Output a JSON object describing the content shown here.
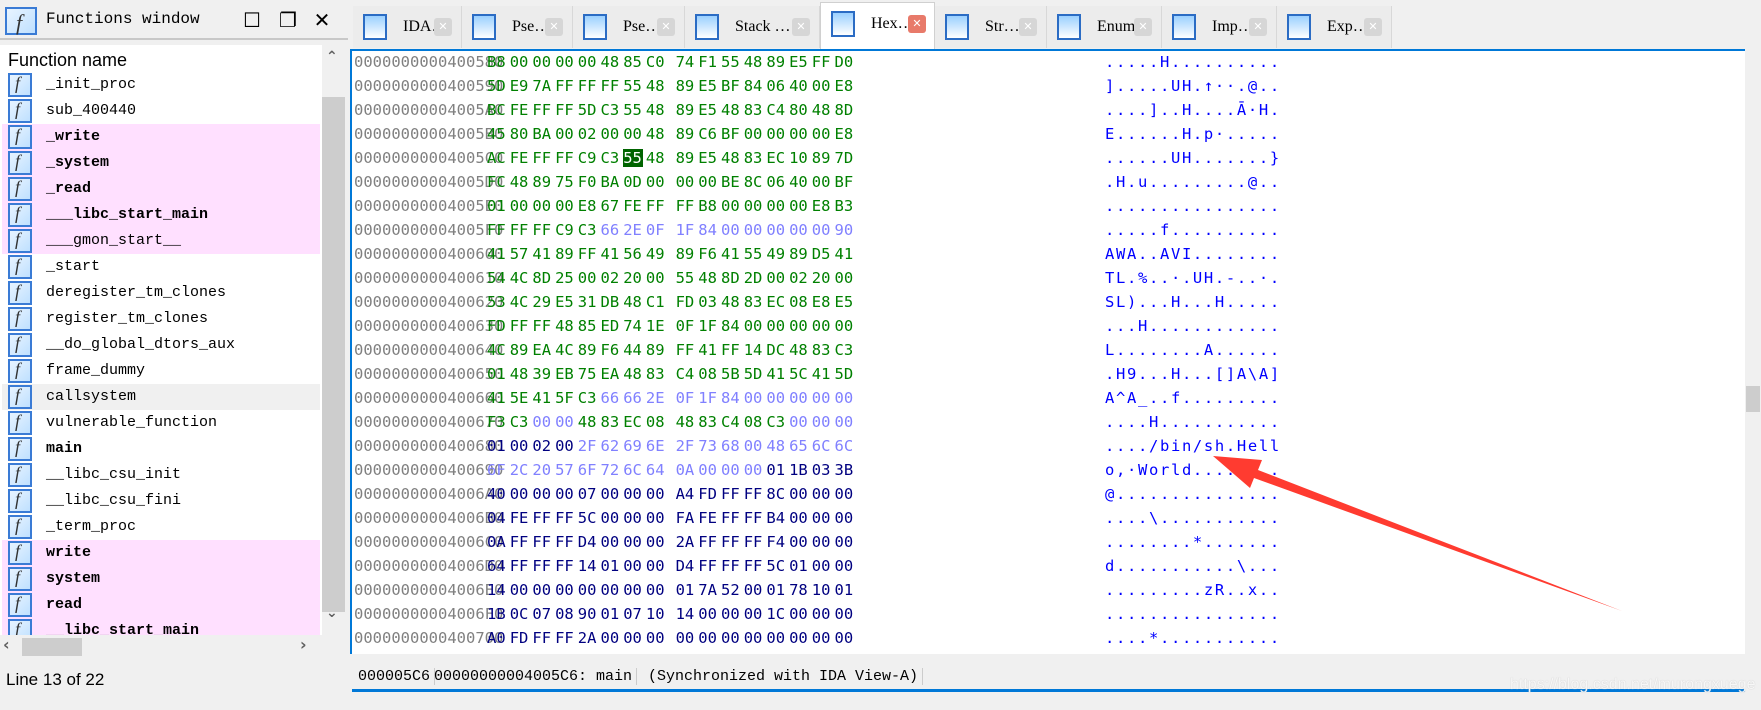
{
  "functions_window": {
    "title": "Functions window",
    "column_header": "Function name",
    "status": "Line 13 of 22",
    "items": [
      {
        "name": "_init_proc",
        "style": ""
      },
      {
        "name": "sub_400440",
        "style": ""
      },
      {
        "name": "_write",
        "style": "pink bold"
      },
      {
        "name": "_system",
        "style": "pink bold"
      },
      {
        "name": "_read",
        "style": "pink bold"
      },
      {
        "name": "___libc_start_main",
        "style": "pink bold"
      },
      {
        "name": "___gmon_start__",
        "style": "pink"
      },
      {
        "name": "_start",
        "style": ""
      },
      {
        "name": "deregister_tm_clones",
        "style": ""
      },
      {
        "name": "register_tm_clones",
        "style": ""
      },
      {
        "name": "__do_global_dtors_aux",
        "style": ""
      },
      {
        "name": "frame_dummy",
        "style": ""
      },
      {
        "name": "callsystem",
        "style": "sel"
      },
      {
        "name": "vulnerable_function",
        "style": ""
      },
      {
        "name": "main",
        "style": "bold"
      },
      {
        "name": "__libc_csu_init",
        "style": ""
      },
      {
        "name": "__libc_csu_fini",
        "style": ""
      },
      {
        "name": "_term_proc",
        "style": ""
      },
      {
        "name": "write",
        "style": "pink bold"
      },
      {
        "name": "system",
        "style": "pink bold"
      },
      {
        "name": "read",
        "style": "pink bold"
      },
      {
        "name": "__libc_start_main",
        "style": "pink bold"
      }
    ]
  },
  "tabs": [
    {
      "label": "IDA…",
      "icon": "disassembly-icon",
      "active": false
    },
    {
      "label": "Pse…",
      "icon": "pseudocode-icon",
      "active": false
    },
    {
      "label": "Pse…",
      "icon": "pseudocode-icon",
      "active": false
    },
    {
      "label": "Stack …",
      "icon": "stack-icon",
      "active": false
    },
    {
      "label": "Hex…",
      "icon": "hex-icon",
      "active": true
    },
    {
      "label": "Str…",
      "icon": "strings-icon",
      "active": false
    },
    {
      "label": "Enums",
      "icon": "enums-icon",
      "active": false
    },
    {
      "label": "Imp…",
      "icon": "imports-icon",
      "active": false
    },
    {
      "label": "Exp…",
      "icon": "exports-icon",
      "active": false
    }
  ],
  "colors": {
    "code": "#008000",
    "unexplored": "#8080ff",
    "data": "#000080",
    "ascii": "#0000ff",
    "address": "#808080",
    "cursor_bg": "#006400",
    "arrow": "#ff3b30"
  },
  "hex_view": {
    "cursor": {
      "row": "00000000004005C0",
      "byte_index": 6
    },
    "rows": [
      {
        "addr": "0000000000400580",
        "bytes": "B8 00 00 00 00 48 85 C0 74 F1 55 48 89 E5 FF D0",
        "types": "cccccccccccccccc",
        "ascii": ".....H.........."
      },
      {
        "addr": "0000000000400590",
        "bytes": "5D E9 7A FF FF FF 55 48 89 E5 BF 84 06 40 00 E8",
        "types": "cccccccccccccccc",
        "ascii": "].....UH.↑··.@.."
      },
      {
        "addr": "00000000004005A0",
        "bytes": "BC FE FF FF 5D C3 55 48 89 E5 48 83 C4 80 48 8D",
        "types": "cccccccccccccccc",
        "ascii": "....]..H....Ā·H."
      },
      {
        "addr": "00000000004005B0",
        "bytes": "45 80 BA 00 02 00 00 48 89 C6 BF 00 00 00 00 E8",
        "types": "cccccccccccccccc",
        "ascii": "E......H.p·....."
      },
      {
        "addr": "00000000004005C0",
        "bytes": "AC FE FF FF C9 C3 55 48 89 E5 48 83 EC 10 89 7D",
        "types": "cccccccccccccccc",
        "ascii": "......UH.......}"
      },
      {
        "addr": "00000000004005D0",
        "bytes": "FC 48 89 75 F0 BA 0D 00 00 00 BE 8C 06 40 00 BF",
        "types": "cccccccccccccccc",
        "ascii": ".H.u.........@.."
      },
      {
        "addr": "00000000004005E0",
        "bytes": "01 00 00 00 E8 67 FE FF FF B8 00 00 00 00 E8 B3",
        "types": "cccccccccccccccc",
        "ascii": "................"
      },
      {
        "addr": "00000000004005F0",
        "bytes": "FF FF FF C9 C3 66 2E 0F 1F 84 00 00 00 00 00 90",
        "types": "cccccaaaaaaaaaaa",
        "ascii": ".....f.........."
      },
      {
        "addr": "0000000000400600",
        "bytes": "41 57 41 89 FF 41 56 49 89 F6 41 55 49 89 D5 41",
        "types": "cccccccccccccccc",
        "ascii": "AWA..AVI........"
      },
      {
        "addr": "0000000000400610",
        "bytes": "54 4C 8D 25 00 02 20 00 55 48 8D 2D 00 02 20 00",
        "types": "cccccccccccccccc",
        "ascii": "TL.%..·.UH.-..·."
      },
      {
        "addr": "0000000000400620",
        "bytes": "53 4C 29 E5 31 DB 48 C1 FD 03 48 83 EC 08 E8 E5",
        "types": "cccccccccccccccc",
        "ascii": "SL)...H...H....."
      },
      {
        "addr": "0000000000400630",
        "bytes": "FD FF FF 48 85 ED 74 1E 0F 1F 84 00 00 00 00 00",
        "types": "cccccccccccccccc",
        "ascii": "...H............"
      },
      {
        "addr": "0000000000400640",
        "bytes": "4C 89 EA 4C 89 F6 44 89 FF 41 FF 14 DC 48 83 C3",
        "types": "cccccccccccccccc",
        "ascii": "L........A......"
      },
      {
        "addr": "0000000000400650",
        "bytes": "01 48 39 EB 75 EA 48 83 C4 08 5B 5D 41 5C 41 5D",
        "types": "cccccccccccccccc",
        "ascii": ".H9...H...[]A\\A]"
      },
      {
        "addr": "0000000000400660",
        "bytes": "41 5E 41 5F C3 66 66 2E 0F 1F 84 00 00 00 00 00",
        "types": "cccccaaaaaaaaaaa",
        "ascii": "A^A_..f........."
      },
      {
        "addr": "0000000000400670",
        "bytes": "F3 C3 00 00 48 83 EC 08 48 83 C4 08 C3 00 00 00",
        "types": "ccaacccccccccaaa",
        "ascii": "....H..........."
      },
      {
        "addr": "0000000000400680",
        "bytes": "01 00 02 00 2F 62 69 6E 2F 73 68 00 48 65 6C 6C",
        "types": "ddddaaaaaaaaaaaa",
        "ascii": "..../bin/sh.Hell"
      },
      {
        "addr": "0000000000400690",
        "bytes": "6F 2C 20 57 6F 72 6C 64 0A 00 00 00 01 1B 03 3B",
        "types": "aaaaaaaaaaaadddd",
        "ascii": "o,·World........"
      },
      {
        "addr": "00000000004006A0",
        "bytes": "40 00 00 00 07 00 00 00 A4 FD FF FF 8C 00 00 00",
        "types": "dddddddddddddddd",
        "ascii": "@..............."
      },
      {
        "addr": "00000000004006B0",
        "bytes": "04 FE FF FF 5C 00 00 00 FA FE FF FF B4 00 00 00",
        "types": "dddddddddddddddd",
        "ascii": "....\\..........."
      },
      {
        "addr": "00000000004006C0",
        "bytes": "0A FF FF FF D4 00 00 00 2A FF FF FF F4 00 00 00",
        "types": "dddddddddddddddd",
        "ascii": "........*......."
      },
      {
        "addr": "00000000004006D0",
        "bytes": "64 FF FF FF 14 01 00 00 D4 FF FF FF 5C 01 00 00",
        "types": "dddddddddddddddd",
        "ascii": "d...........\\..."
      },
      {
        "addr": "00000000004006E0",
        "bytes": "14 00 00 00 00 00 00 00 01 7A 52 00 01 78 10 01",
        "types": "dddddddddddddddd",
        "ascii": ".........zR..x.."
      },
      {
        "addr": "00000000004006F0",
        "bytes": "1B 0C 07 08 90 01 07 10 14 00 00 00 1C 00 00 00",
        "types": "dddddddddddddddd",
        "ascii": "................"
      },
      {
        "addr": "0000000000400700",
        "bytes": "A0 FD FF FF 2A 00 00 00 00 00 00 00 00 00 00 00",
        "types": "dddddddddddddddd",
        "ascii": "....*..........."
      }
    ]
  },
  "status_bar": {
    "offset": "000005C6",
    "location": "00000000004005C6: main",
    "sync": "(Synchronized with IDA View-A)"
  },
  "watermark": "https://blog.csdn.net/murongxuege"
}
